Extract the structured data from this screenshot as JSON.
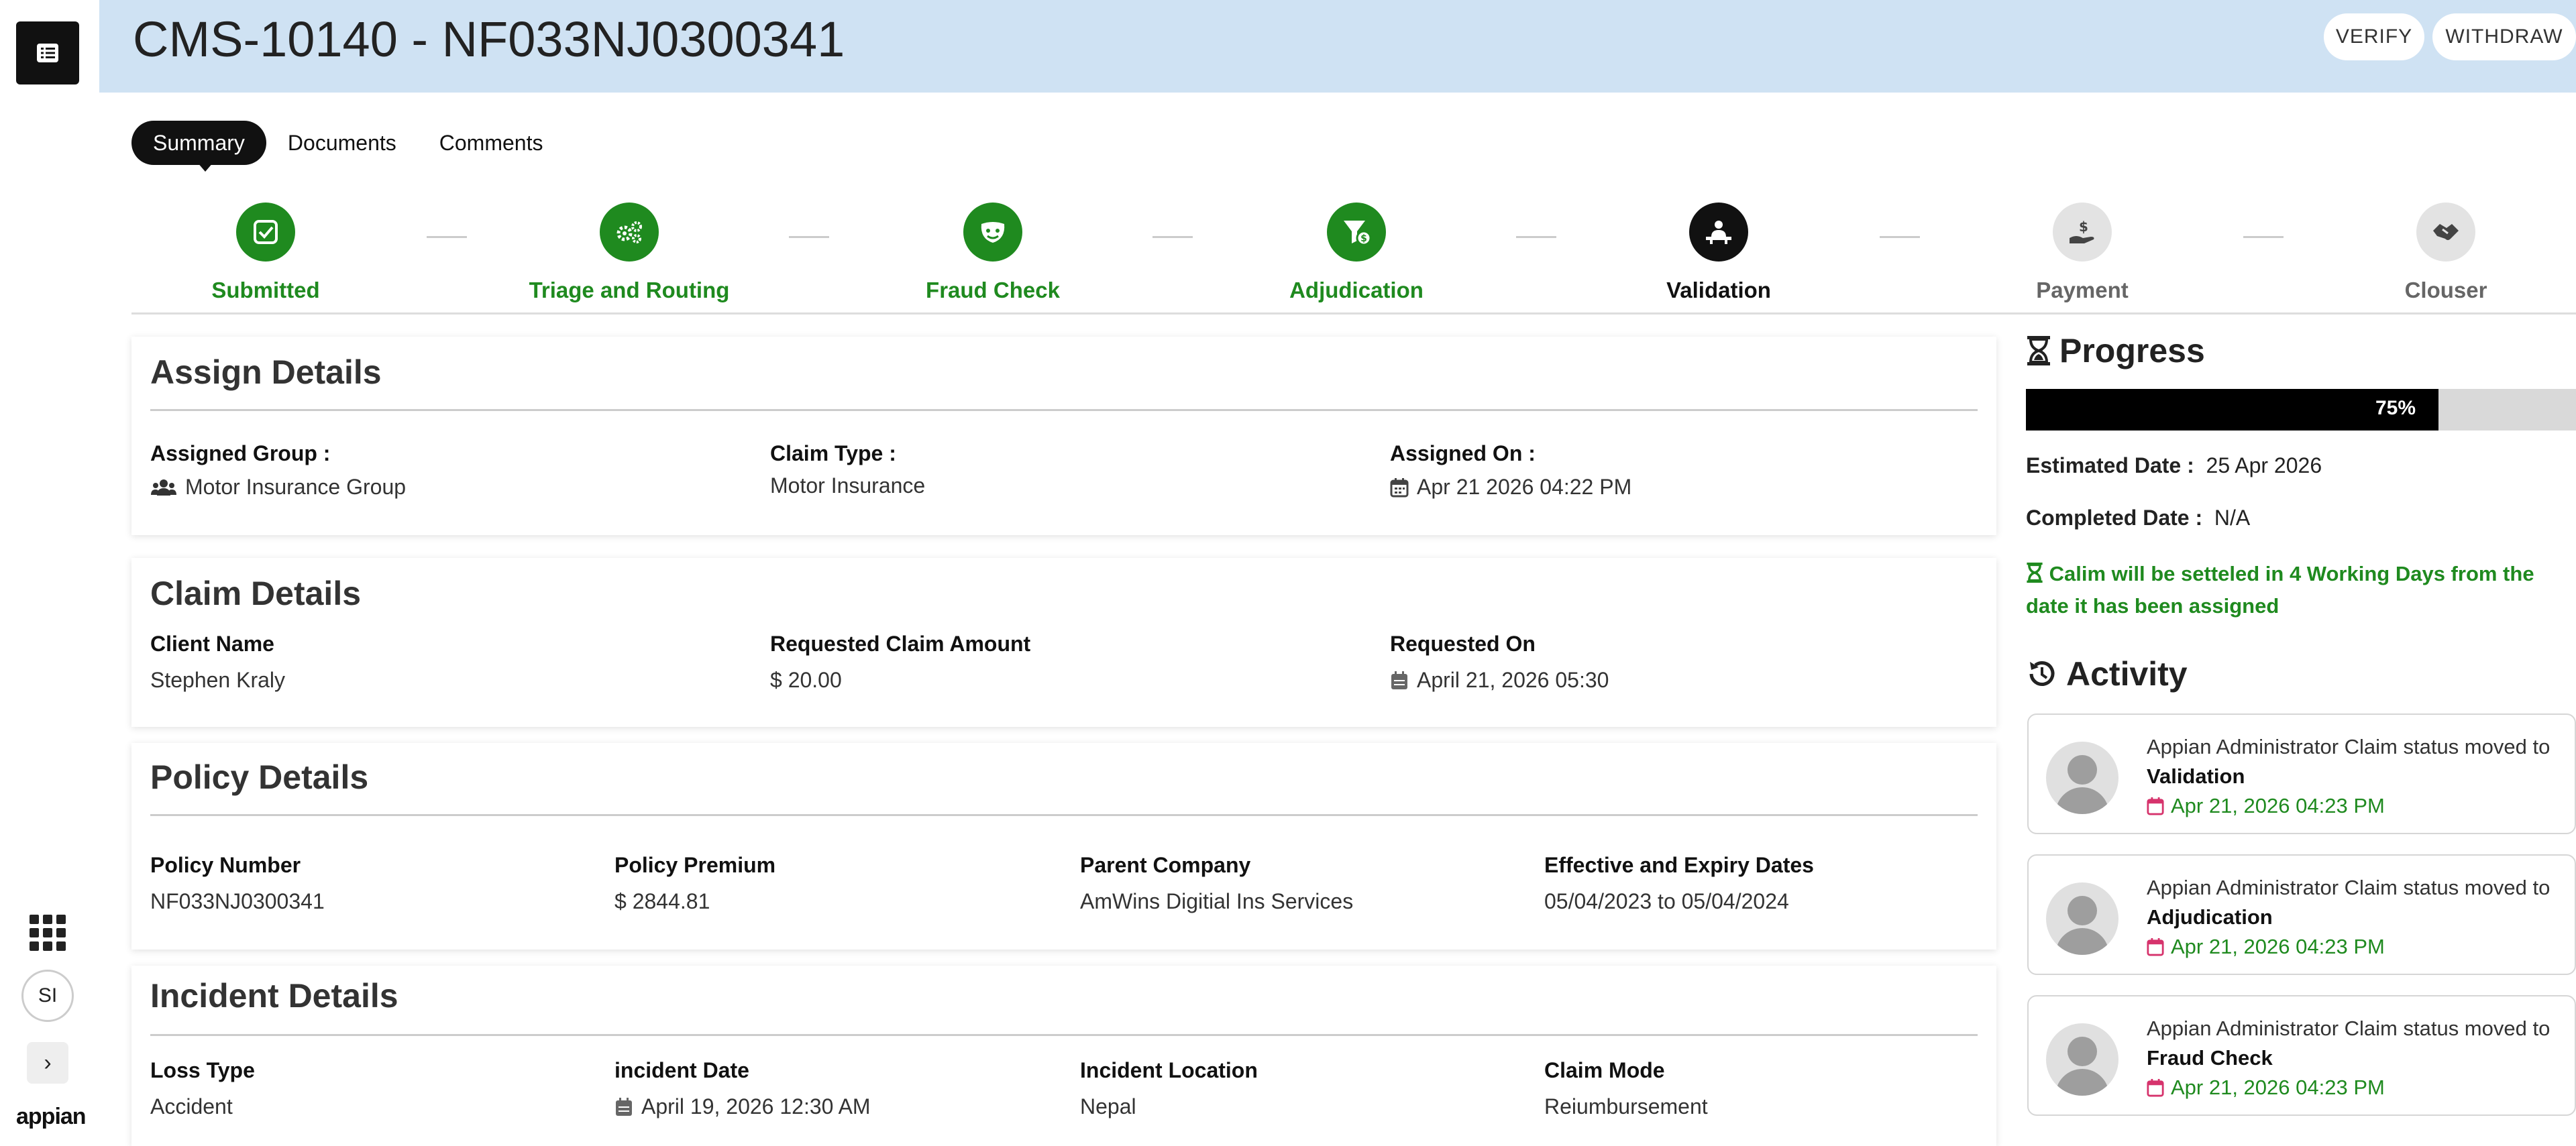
{
  "header": {
    "title": "CMS-10140 - NF033NJ0300341",
    "verify_label": "VERIFY",
    "withdraw_label": "WITHDRAW"
  },
  "rail": {
    "avatar_initials": "SI",
    "logo_text": "appian"
  },
  "tabs": [
    {
      "label": "Summary",
      "active": true
    },
    {
      "label": "Documents",
      "active": false
    },
    {
      "label": "Comments",
      "active": false
    }
  ],
  "stepper": [
    {
      "label": "Submitted",
      "status": "done",
      "icon": "check-square-icon"
    },
    {
      "label": "Triage and Routing",
      "status": "done",
      "icon": "gears-icon"
    },
    {
      "label": "Fraud Check",
      "status": "done",
      "icon": "mask-icon"
    },
    {
      "label": "Adjudication",
      "status": "done",
      "icon": "funnel-dollar-icon"
    },
    {
      "label": "Validation",
      "status": "current",
      "icon": "person-desk-icon"
    },
    {
      "label": "Payment",
      "status": "pending",
      "icon": "hand-dollar-icon"
    },
    {
      "label": "Clouser",
      "status": "pending",
      "icon": "handshake-icon"
    }
  ],
  "assign_details": {
    "title": "Assign Details",
    "group_label": "Assigned Group :",
    "group_value": "Motor Insurance Group",
    "claim_type_label": "Claim Type :",
    "claim_type_value": "Motor Insurance",
    "assigned_on_label": "Assigned On :",
    "assigned_on_value": "Apr 21 2026  04:22 PM"
  },
  "claim_details": {
    "title": "Claim Details",
    "client_label": "Client Name",
    "client_value": "Stephen Kraly",
    "amount_label": "Requested Claim Amount",
    "amount_value": "$ 20.00",
    "requested_on_label": "Requested On",
    "requested_on_value": "April 21, 2026 05:30"
  },
  "policy_details": {
    "title": "Policy Details",
    "number_label": "Policy Number",
    "number_value": "NF033NJ0300341",
    "premium_label": "Policy Premium",
    "premium_value": "$ 2844.81",
    "parent_label": "Parent Company",
    "parent_value": "AmWins Digitial Ins Services",
    "dates_label": "Effective and Expiry Dates",
    "dates_value": "05/04/2023 to 05/04/2024"
  },
  "incident_details": {
    "title": "Incident Details",
    "loss_label": "Loss Type",
    "loss_value": "Accident",
    "date_label": "incident Date",
    "date_value": "April 19, 2026 12:30 AM",
    "location_label": "Incident Location",
    "location_value": "Nepal",
    "mode_label": "Claim Mode",
    "mode_value": "Reiumbursement"
  },
  "progress": {
    "title": "Progress",
    "percent": 75,
    "percent_label": "75%",
    "estimated_label": "Estimated Date :",
    "estimated_value": "25 Apr 2026",
    "completed_label": "Completed Date :",
    "completed_value": "N/A",
    "note": "Calim will be setteled in 4 Working Days from the date it has been assigned"
  },
  "activity": {
    "title": "Activity",
    "items": [
      {
        "text": "Appian Administrator Claim status moved to",
        "status": "Validation",
        "time": "Apr 21, 2026 04:23 PM"
      },
      {
        "text": "Appian Administrator Claim status moved to",
        "status": "Adjudication",
        "time": "Apr 21, 2026 04:23 PM"
      },
      {
        "text": "Appian Administrator Claim status moved to",
        "status": "Fraud Check",
        "time": "Apr 21, 2026 04:23 PM"
      }
    ]
  },
  "colors": {
    "header_bg": "#cfe2f3",
    "done_green": "#1f8a1f",
    "current_black": "#111111",
    "pending_gray": "#e3e3e3"
  }
}
